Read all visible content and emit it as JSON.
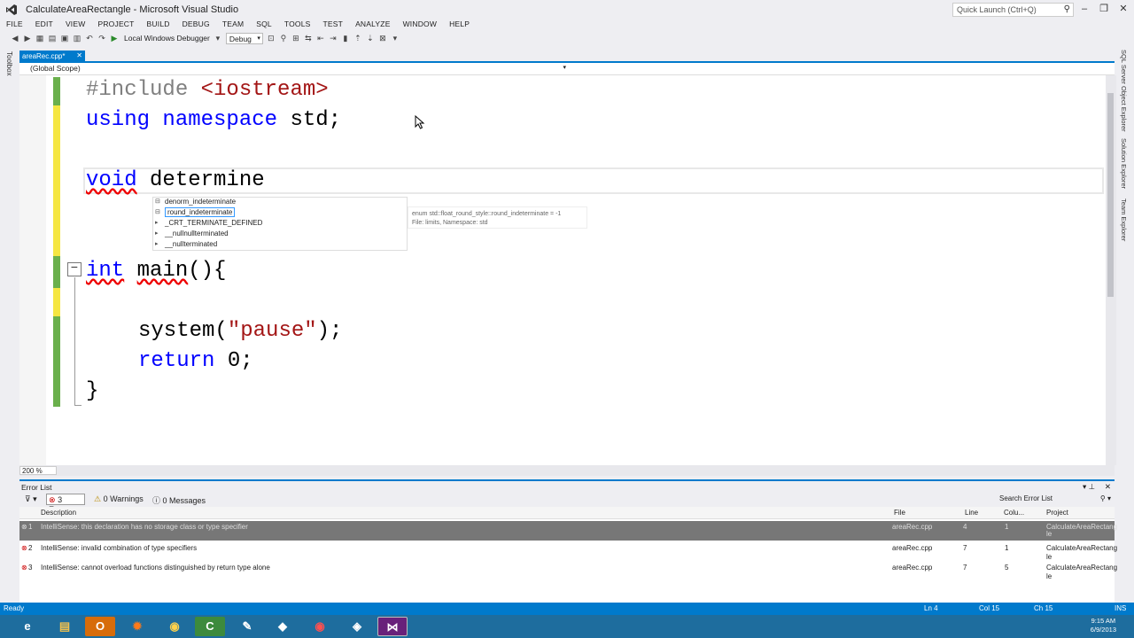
{
  "window": {
    "title": "CalculateAreaRectangle - Microsoft Visual Studio",
    "quick_launch_placeholder": "Quick Launch (Ctrl+Q)"
  },
  "menu": [
    "FILE",
    "EDIT",
    "VIEW",
    "PROJECT",
    "BUILD",
    "DEBUG",
    "TEAM",
    "SQL",
    "TOOLS",
    "TEST",
    "ANALYZE",
    "WINDOW",
    "HELP"
  ],
  "toolbar": {
    "debugger_label": "Local Windows Debugger",
    "config_value": "Debug"
  },
  "side_panels": {
    "left": "Toolbox",
    "right": [
      "SQL Server Object Explorer",
      "Solution Explorer",
      "Team Explorer"
    ]
  },
  "document": {
    "tab_label": "areaRec.cpp*",
    "scope": "(Global Scope)",
    "zoom": "200 %"
  },
  "code": {
    "line1_pp": "#include",
    "line1_inc": "<iostream>",
    "line2_kw1": "using",
    "line2_kw2": "namespace",
    "line2_rest": "std;",
    "line4_kw": "void",
    "line4_rest": " determine",
    "line5_kw": "int",
    "line5_name": "main",
    "line5_rest": "(){",
    "line7_fn": "system(",
    "line7_str": "\"pause\"",
    "line7_end": ");",
    "line8_kw": "return",
    "line8_rest": " 0;",
    "line9": "}"
  },
  "intellisense": {
    "items": [
      "denorm_indeterminate",
      "round_indeterminate",
      "_CRT_TERMINATE_DEFINED",
      "__nullnullterminated",
      "__nullterminated"
    ],
    "tooltip_line1": "enum std::float_round_style::round_indeterminate = -1",
    "tooltip_line2": "File: limits, Namespace: std"
  },
  "error_list": {
    "title": "Error List",
    "errors_btn": "3 Errors",
    "warnings_btn": "0 Warnings",
    "messages_btn": "0 Messages",
    "search_placeholder": "Search Error List",
    "columns": {
      "description": "Description",
      "file": "File",
      "line": "Line",
      "column": "Colu...",
      "project": "Project"
    },
    "rows": [
      {
        "num": "1",
        "description": "IntelliSense: this declaration has no storage class or type specifier",
        "file": "areaRec.cpp",
        "line": "4",
        "column": "1",
        "project_1": "CalculateAreaRectang",
        "project_2": "le"
      },
      {
        "num": "2",
        "description": "IntelliSense: invalid combination of type specifiers",
        "file": "areaRec.cpp",
        "line": "7",
        "column": "1",
        "project_1": "CalculateAreaRectang",
        "project_2": "le"
      },
      {
        "num": "3",
        "description": "IntelliSense: cannot overload functions distinguished by return type alone",
        "file": "areaRec.cpp",
        "line": "7",
        "column": "5",
        "project_1": "CalculateAreaRectang",
        "project_2": "le"
      }
    ]
  },
  "status": {
    "left": "Ready",
    "ln": "Ln 4",
    "col": "Col 15",
    "ch": "Ch 15",
    "mode": "INS"
  },
  "taskbar": {
    "time": "9:15 AM",
    "date": "6/9/2013"
  },
  "colors": {
    "accent": "#007acc",
    "keyword": "#0000ff",
    "string": "#a31515",
    "taskbar": "#1e6d9e"
  }
}
